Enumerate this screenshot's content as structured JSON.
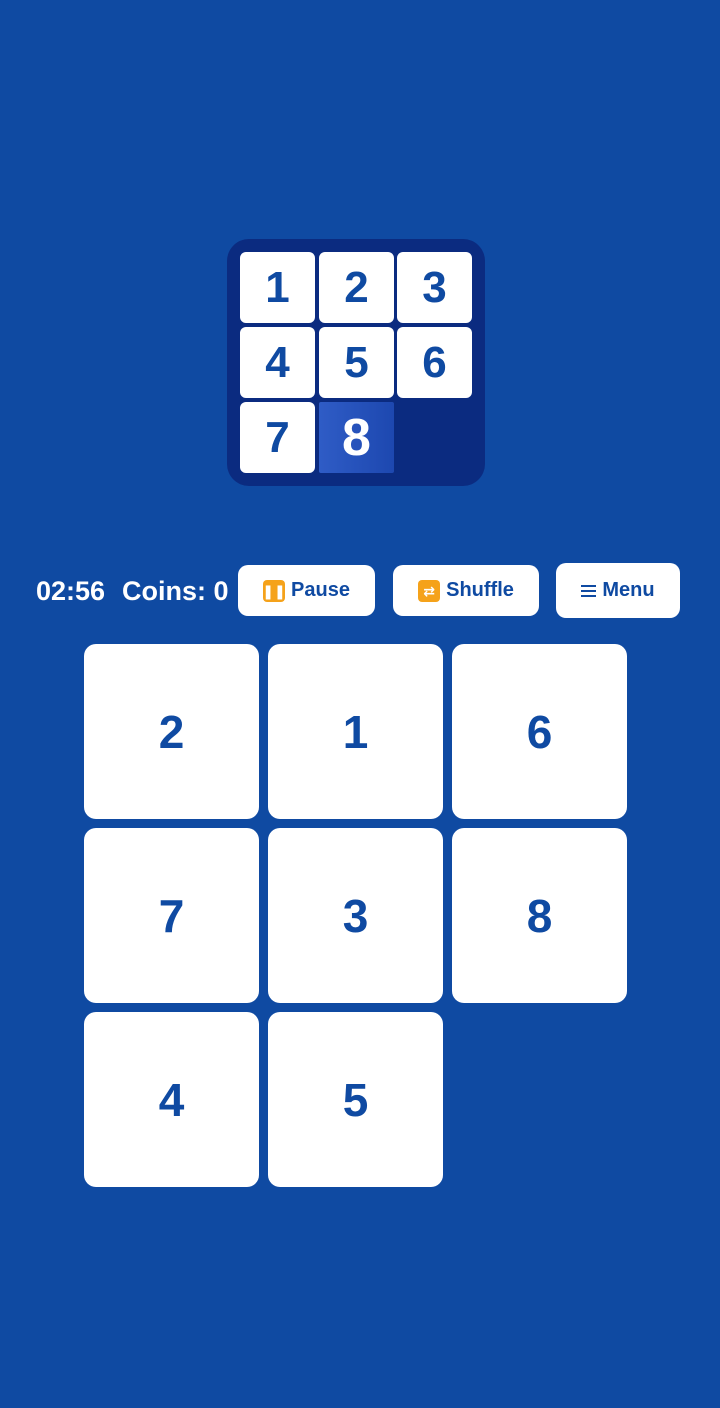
{
  "goal": {
    "tiles": [
      "1",
      "2",
      "3",
      "4",
      "5",
      "6",
      "7",
      "8"
    ],
    "highlighted_tile": "8"
  },
  "status": {
    "timer": "02:56",
    "coins": "Coins: 0"
  },
  "controls": {
    "pause_label": "Pause",
    "pause_icon": "pause-icon",
    "shuffle_label": "Shuffle",
    "shuffle_icon": "shuffle-icon",
    "menu_label": "Menu",
    "menu_icon": "hamburger-menu-icon"
  },
  "board": {
    "tiles": [
      "2",
      "1",
      "6",
      "7",
      "3",
      "8",
      "4",
      "5"
    ],
    "empty_position": "bottom-right"
  },
  "colors": {
    "background": "#0f4aa2",
    "goal_board": "#0b2b80",
    "tile": "#ffffff",
    "tile_text": "#0f4aa2",
    "icon_accent": "#f5a21a"
  }
}
